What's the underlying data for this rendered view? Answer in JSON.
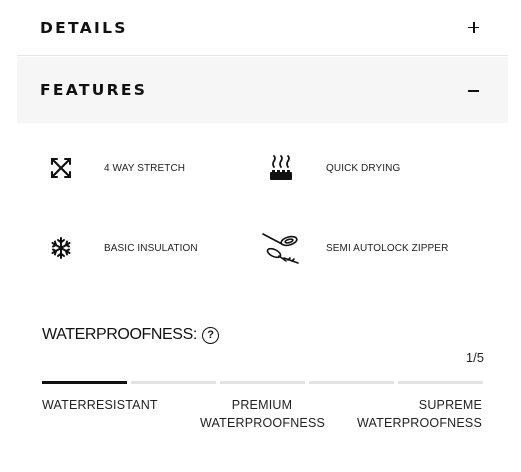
{
  "details": {
    "title": "DETAILS",
    "toggle_icon": "plus-icon"
  },
  "features": {
    "title": "FEATURES",
    "toggle_icon": "minus-icon",
    "items": [
      {
        "label": "4 WAY STRETCH",
        "icon": "stretch-arrows-icon"
      },
      {
        "label": "QUICK DRYING",
        "icon": "quick-drying-icon"
      },
      {
        "label": "BASIC INSULATION",
        "icon": "snowflake-icon"
      },
      {
        "label": "SEMI AUTOLOCK ZIPPER",
        "icon": "zipper-icon"
      }
    ]
  },
  "waterproofness": {
    "title": "WATERPROOFNESS:",
    "help_glyph": "?",
    "page_indicator": "1/5",
    "level": 1,
    "level_max": 5,
    "labels": [
      {
        "line1": "WATERRESISTANT",
        "line2": ""
      },
      {
        "line1": "PREMIUM",
        "line2": "WATERPROOFNESS"
      },
      {
        "line1": "SUPREME",
        "line2": "WATERPROOFNESS"
      }
    ]
  },
  "colors": {
    "active_segment": "#111111",
    "inactive_segment": "#e3e3e3",
    "header_bg": "#f6f6f6"
  }
}
